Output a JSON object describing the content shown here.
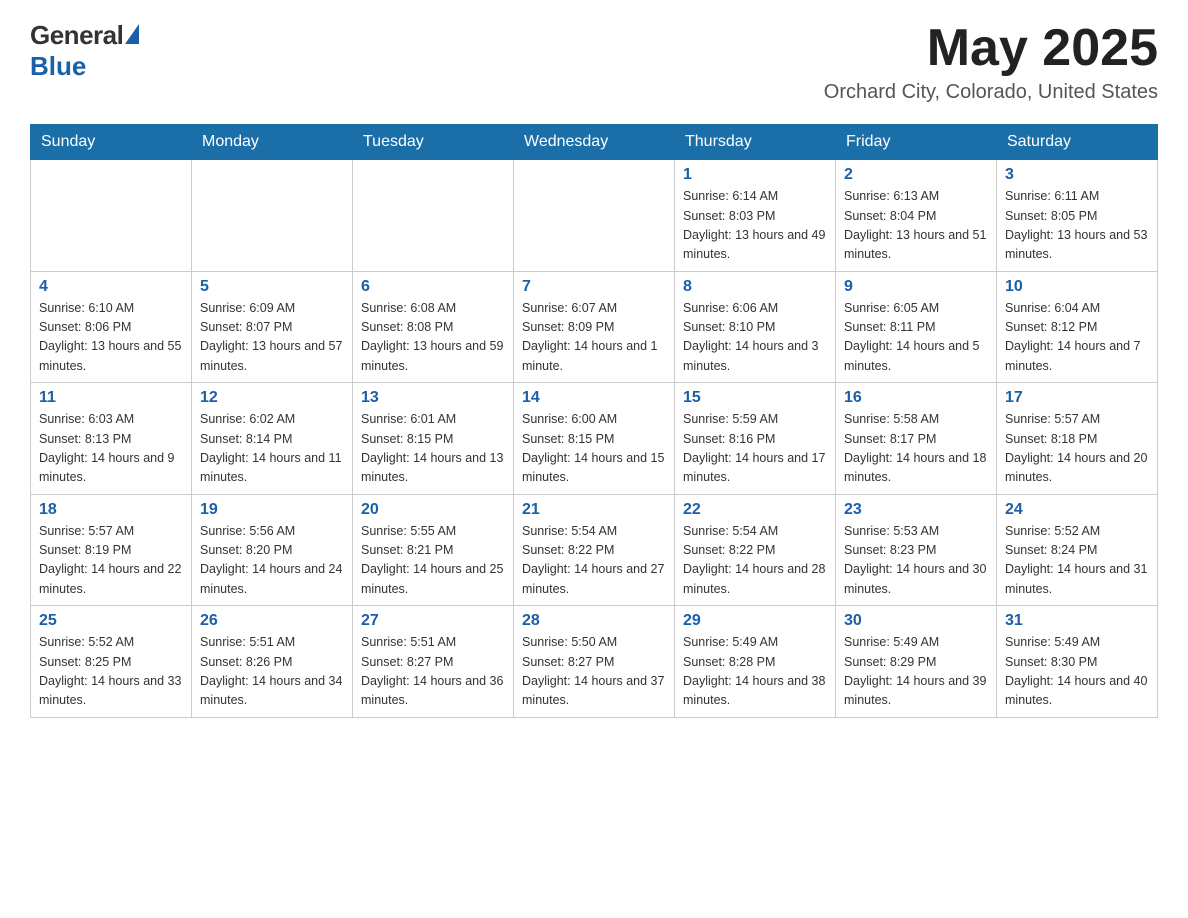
{
  "header": {
    "logo_general": "General",
    "logo_blue": "Blue",
    "month_year": "May 2025",
    "location": "Orchard City, Colorado, United States"
  },
  "days_of_week": [
    "Sunday",
    "Monday",
    "Tuesday",
    "Wednesday",
    "Thursday",
    "Friday",
    "Saturday"
  ],
  "weeks": [
    [
      {
        "day": "",
        "info": ""
      },
      {
        "day": "",
        "info": ""
      },
      {
        "day": "",
        "info": ""
      },
      {
        "day": "",
        "info": ""
      },
      {
        "day": "1",
        "info": "Sunrise: 6:14 AM\nSunset: 8:03 PM\nDaylight: 13 hours and 49 minutes."
      },
      {
        "day": "2",
        "info": "Sunrise: 6:13 AM\nSunset: 8:04 PM\nDaylight: 13 hours and 51 minutes."
      },
      {
        "day": "3",
        "info": "Sunrise: 6:11 AM\nSunset: 8:05 PM\nDaylight: 13 hours and 53 minutes."
      }
    ],
    [
      {
        "day": "4",
        "info": "Sunrise: 6:10 AM\nSunset: 8:06 PM\nDaylight: 13 hours and 55 minutes."
      },
      {
        "day": "5",
        "info": "Sunrise: 6:09 AM\nSunset: 8:07 PM\nDaylight: 13 hours and 57 minutes."
      },
      {
        "day": "6",
        "info": "Sunrise: 6:08 AM\nSunset: 8:08 PM\nDaylight: 13 hours and 59 minutes."
      },
      {
        "day": "7",
        "info": "Sunrise: 6:07 AM\nSunset: 8:09 PM\nDaylight: 14 hours and 1 minute."
      },
      {
        "day": "8",
        "info": "Sunrise: 6:06 AM\nSunset: 8:10 PM\nDaylight: 14 hours and 3 minutes."
      },
      {
        "day": "9",
        "info": "Sunrise: 6:05 AM\nSunset: 8:11 PM\nDaylight: 14 hours and 5 minutes."
      },
      {
        "day": "10",
        "info": "Sunrise: 6:04 AM\nSunset: 8:12 PM\nDaylight: 14 hours and 7 minutes."
      }
    ],
    [
      {
        "day": "11",
        "info": "Sunrise: 6:03 AM\nSunset: 8:13 PM\nDaylight: 14 hours and 9 minutes."
      },
      {
        "day": "12",
        "info": "Sunrise: 6:02 AM\nSunset: 8:14 PM\nDaylight: 14 hours and 11 minutes."
      },
      {
        "day": "13",
        "info": "Sunrise: 6:01 AM\nSunset: 8:15 PM\nDaylight: 14 hours and 13 minutes."
      },
      {
        "day": "14",
        "info": "Sunrise: 6:00 AM\nSunset: 8:15 PM\nDaylight: 14 hours and 15 minutes."
      },
      {
        "day": "15",
        "info": "Sunrise: 5:59 AM\nSunset: 8:16 PM\nDaylight: 14 hours and 17 minutes."
      },
      {
        "day": "16",
        "info": "Sunrise: 5:58 AM\nSunset: 8:17 PM\nDaylight: 14 hours and 18 minutes."
      },
      {
        "day": "17",
        "info": "Sunrise: 5:57 AM\nSunset: 8:18 PM\nDaylight: 14 hours and 20 minutes."
      }
    ],
    [
      {
        "day": "18",
        "info": "Sunrise: 5:57 AM\nSunset: 8:19 PM\nDaylight: 14 hours and 22 minutes."
      },
      {
        "day": "19",
        "info": "Sunrise: 5:56 AM\nSunset: 8:20 PM\nDaylight: 14 hours and 24 minutes."
      },
      {
        "day": "20",
        "info": "Sunrise: 5:55 AM\nSunset: 8:21 PM\nDaylight: 14 hours and 25 minutes."
      },
      {
        "day": "21",
        "info": "Sunrise: 5:54 AM\nSunset: 8:22 PM\nDaylight: 14 hours and 27 minutes."
      },
      {
        "day": "22",
        "info": "Sunrise: 5:54 AM\nSunset: 8:22 PM\nDaylight: 14 hours and 28 minutes."
      },
      {
        "day": "23",
        "info": "Sunrise: 5:53 AM\nSunset: 8:23 PM\nDaylight: 14 hours and 30 minutes."
      },
      {
        "day": "24",
        "info": "Sunrise: 5:52 AM\nSunset: 8:24 PM\nDaylight: 14 hours and 31 minutes."
      }
    ],
    [
      {
        "day": "25",
        "info": "Sunrise: 5:52 AM\nSunset: 8:25 PM\nDaylight: 14 hours and 33 minutes."
      },
      {
        "day": "26",
        "info": "Sunrise: 5:51 AM\nSunset: 8:26 PM\nDaylight: 14 hours and 34 minutes."
      },
      {
        "day": "27",
        "info": "Sunrise: 5:51 AM\nSunset: 8:27 PM\nDaylight: 14 hours and 36 minutes."
      },
      {
        "day": "28",
        "info": "Sunrise: 5:50 AM\nSunset: 8:27 PM\nDaylight: 14 hours and 37 minutes."
      },
      {
        "day": "29",
        "info": "Sunrise: 5:49 AM\nSunset: 8:28 PM\nDaylight: 14 hours and 38 minutes."
      },
      {
        "day": "30",
        "info": "Sunrise: 5:49 AM\nSunset: 8:29 PM\nDaylight: 14 hours and 39 minutes."
      },
      {
        "day": "31",
        "info": "Sunrise: 5:49 AM\nSunset: 8:30 PM\nDaylight: 14 hours and 40 minutes."
      }
    ]
  ]
}
